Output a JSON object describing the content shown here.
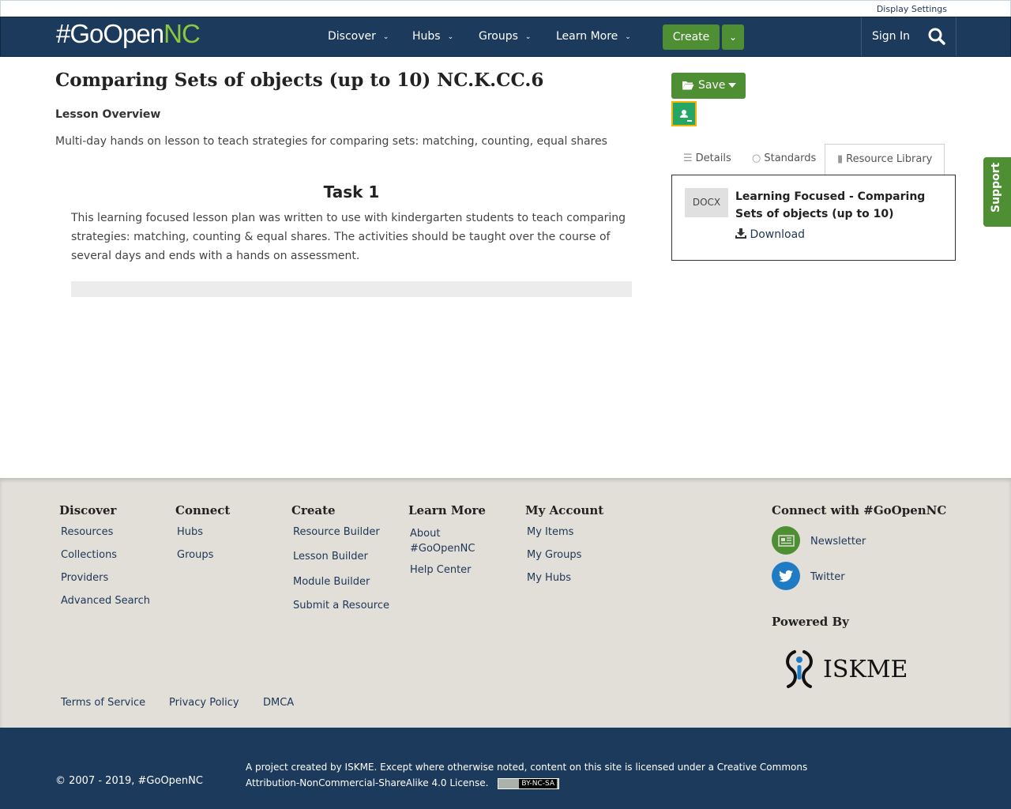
{
  "utility": {
    "display_settings": "Display Settings"
  },
  "nav": {
    "logo_prefix": "#GoOpen",
    "logo_suffix": "NC",
    "items": [
      {
        "label": "Discover"
      },
      {
        "label": "Hubs"
      },
      {
        "label": "Groups"
      },
      {
        "label": "Learn More"
      }
    ],
    "create_label": "Create",
    "sign_in": "Sign In"
  },
  "main": {
    "title": "Comparing Sets of objects (up to 10) NC.K.CC.6",
    "overview_heading": "Lesson Overview",
    "overview_text": "Multi-day hands on lesson to teach strategies for comparing sets: matching, counting, equal shares",
    "task_title": "Task 1",
    "task_text": "This learning focused lesson plan was written to use with kindergarten students to teach comparing strategies: matching, counting & equal shares. The activities should be taught over the course of several days and ends with a hands on assessment."
  },
  "sidebar": {
    "save_label": "Save",
    "tabs": [
      {
        "label": "Details"
      },
      {
        "label": "Standards"
      },
      {
        "label": "Resource Library"
      }
    ],
    "resource": {
      "type": "DOCX",
      "title": "Learning Focused - Comparing Sets of objects (up to 10)",
      "download_label": "Download"
    },
    "support_label": "Support"
  },
  "footer": {
    "columns": [
      {
        "heading": "Discover",
        "links": [
          "Resources",
          "Collections",
          "Providers",
          "Advanced Search"
        ]
      },
      {
        "heading": "Connect",
        "links": [
          "Hubs",
          "Groups"
        ]
      },
      {
        "heading": "Create",
        "links": [
          "Resource Builder",
          "Lesson Builder",
          "Module Builder",
          "Submit a Resource"
        ]
      },
      {
        "heading": "Learn More",
        "links": [
          "About #GoOpenNC",
          "Help Center"
        ]
      },
      {
        "heading": "My Account",
        "links": [
          "My Items",
          "My Groups",
          "My Hubs"
        ]
      }
    ],
    "connect_heading": "Connect with #GoOpenNC",
    "newsletter": "Newsletter",
    "twitter": "Twitter",
    "powered_by": "Powered By",
    "iskme_text": "ISKME",
    "legal_links": [
      "Terms of Service",
      "Privacy Policy",
      "DMCA"
    ],
    "copyright": "© 2007 - 2019, #GoOpenNC",
    "license_text": "A project created by ISKME. Except where otherwise noted, content on this site is licensed under a Creative Commons Attribution-NonCommercial-ShareAlike 4.0 License.",
    "cc_badge": "BY-NC-SA"
  },
  "colors": {
    "nav_bg": "#1c3a5b",
    "accent_green": "#4e8f34",
    "logo_nc_green": "#8cc63f",
    "footer_bg": "#e2dfd9"
  }
}
